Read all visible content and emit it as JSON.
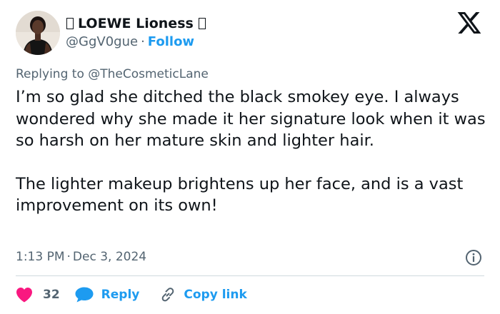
{
  "author": {
    "display_name": "LOEWE Lioness",
    "handle": "@GgV0gue",
    "separator": "·",
    "follow_label": "Follow"
  },
  "reply_context": {
    "prefix": "Replying to",
    "mention": "@TheCosmeticLane"
  },
  "tweet": {
    "paragraphs": [
      "I’m so glad she ditched the black smokey eye. I always wondered why she made it her signature look when it was so harsh on her mature skin and lighter hair.",
      "The lighter makeup brightens up her face, and is a vast improvement on its own!"
    ],
    "time": "1:13 PM",
    "separator": "·",
    "date": "Dec 3, 2024"
  },
  "actions": {
    "like_count": "32",
    "reply_label": "Reply",
    "copy_link_label": "Copy link"
  },
  "icons": {
    "brand": "x-logo-icon",
    "info": "info-icon",
    "like": "heart-icon",
    "reply": "speech-bubble-icon",
    "copy": "link-icon"
  },
  "colors": {
    "text_primary": "#0f1419",
    "text_secondary": "#536471",
    "accent": "#1d9bf0",
    "like": "#f91880",
    "divider": "#cfd9de"
  }
}
